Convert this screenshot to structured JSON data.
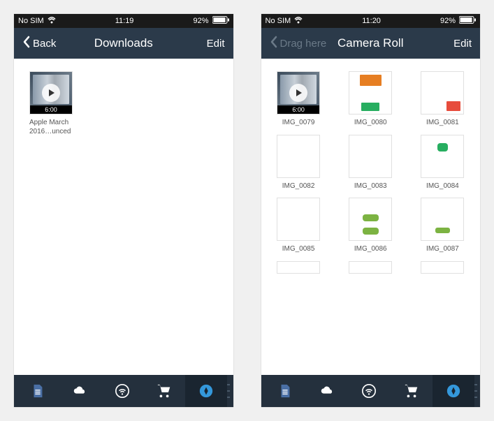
{
  "screens": {
    "left": {
      "status": {
        "carrier": "No SIM",
        "time": "11:19",
        "battery": "92%"
      },
      "nav": {
        "back_label": "Back",
        "title": "Downloads",
        "action": "Edit"
      },
      "items": [
        {
          "caption": "Apple March 2016…unced",
          "type": "video",
          "duration": "6:00"
        }
      ]
    },
    "right": {
      "status": {
        "carrier": "No SIM",
        "time": "11:20",
        "battery": "92%"
      },
      "nav": {
        "back_label": "Drag here",
        "title": "Camera Roll",
        "action": "Edit"
      },
      "items": [
        {
          "caption": "IMG_0079",
          "type": "video",
          "duration": "6:00"
        },
        {
          "caption": "IMG_0080",
          "type": "app-shot",
          "variant": "a"
        },
        {
          "caption": "IMG_0081",
          "type": "app-shot",
          "variant": "b"
        },
        {
          "caption": "IMG_0082",
          "type": "app-shot",
          "variant": "c"
        },
        {
          "caption": "IMG_0083",
          "type": "app-shot",
          "variant": "d"
        },
        {
          "caption": "IMG_0084",
          "type": "app-shot",
          "variant": "e"
        },
        {
          "caption": "IMG_0085",
          "type": "app-shot",
          "variant": "f"
        },
        {
          "caption": "IMG_0086",
          "type": "app-shot",
          "variant": "g"
        },
        {
          "caption": "IMG_0087",
          "type": "app-shot",
          "variant": "h"
        }
      ]
    }
  },
  "tabs": [
    "documents",
    "cloud",
    "wifi-share",
    "store",
    "browser"
  ],
  "colors": {
    "nav": "#2b3a4a",
    "tabbar": "#24303d",
    "accent": "#3498db",
    "doc_tab": "#4a6fa5"
  }
}
